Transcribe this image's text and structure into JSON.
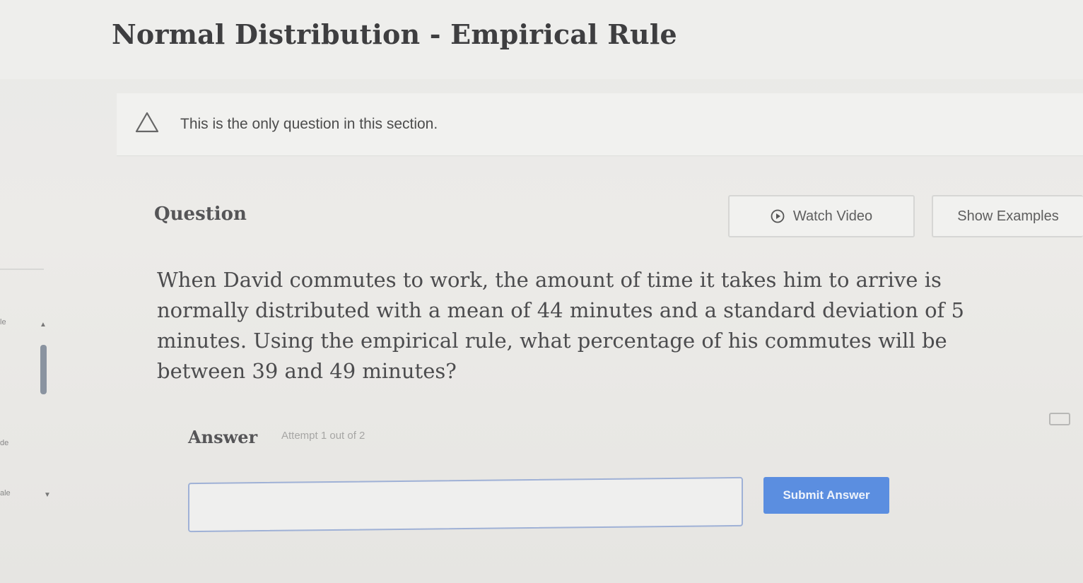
{
  "page": {
    "title": "Normal Distribution - Empirical Rule"
  },
  "notice": {
    "text": "This is the only question in this section.",
    "icon": "warning-triangle-icon"
  },
  "question": {
    "label": "Question",
    "watch_video_label": "Watch Video",
    "show_examples_label": "Show Examples",
    "text": "When David commutes to work, the amount of time it takes him to arrive is normally distributed with a mean of 44 minutes and a standard deviation of 5 minutes. Using the empirical rule, what percentage of his commutes will be between 39 and 49 minutes?"
  },
  "answer": {
    "label": "Answer",
    "attempt_text": "Attempt 1 out of 2",
    "input_value": "",
    "submit_label": "Submit Answer"
  },
  "left_rail": {
    "text_1": "le",
    "text_2": "de",
    "text_3": "ale"
  },
  "colors": {
    "accent": "#5b8ee0",
    "input_border": "#9fb1d6",
    "background": "#ebebe9"
  }
}
